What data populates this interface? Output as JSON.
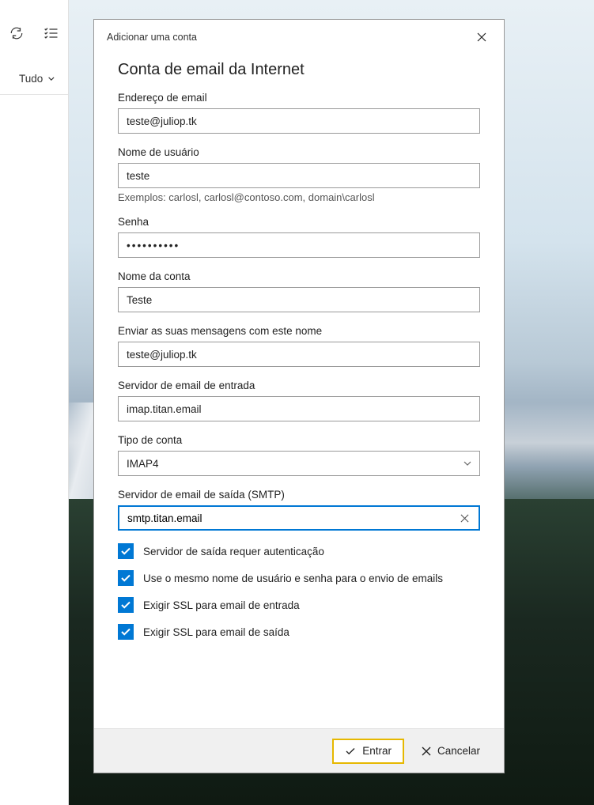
{
  "leftPanel": {
    "filterLabel": "Tudo"
  },
  "dialog": {
    "titlebar": "Adicionar uma conta",
    "heading": "Conta de email da Internet",
    "fields": {
      "email": {
        "label": "Endereço de email",
        "value": "teste@juliop.tk"
      },
      "username": {
        "label": "Nome de usuário",
        "value": "teste",
        "hint": "Exemplos: carlosl, carlosl@contoso.com, domain\\carlosl"
      },
      "password": {
        "label": "Senha",
        "value": "••••••••••"
      },
      "accountName": {
        "label": "Nome da conta",
        "value": "Teste"
      },
      "sendName": {
        "label": "Enviar as suas mensagens com este nome",
        "value": "teste@juliop.tk"
      },
      "incomingServer": {
        "label": "Servidor de email de entrada",
        "value": "imap.titan.email"
      },
      "accountType": {
        "label": "Tipo de conta",
        "value": "IMAP4"
      },
      "outgoingServer": {
        "label": "Servidor de email de saída (SMTP)",
        "value": "smtp.titan.email"
      }
    },
    "checkboxes": {
      "authRequired": "Servidor de saída requer autenticação",
      "sameCreds": "Use o mesmo nome de usuário e senha para o envio de emails",
      "sslIncoming": "Exigir SSL para email de entrada",
      "sslOutgoing": "Exigir SSL para email de saída"
    },
    "buttons": {
      "signin": "Entrar",
      "cancel": "Cancelar"
    }
  }
}
